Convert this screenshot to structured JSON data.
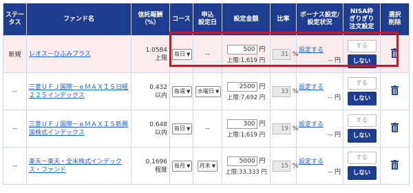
{
  "headers": {
    "status": "ステータス",
    "fund_name": "ファンド名",
    "fee": "信託報酬\n（%）",
    "course": "コース",
    "apply_date": "申込\n設定日",
    "amount": "設定金額",
    "ratio": "比率",
    "bonus": "ボーナス設定/\n設定状況",
    "nisa": "NISA枠\nぎりぎり\n注文設定",
    "delete": "選択\n削除"
  },
  "rows": [
    {
      "status": "新規",
      "fund": "レオス－ひふみプラス",
      "fee_value": "1.0584",
      "fee_note": "上限",
      "course": "毎日",
      "date": "--",
      "amount": "500",
      "yen": "円",
      "limit": "上限:1,619 円",
      "ratio": "31",
      "pct": "%",
      "bonus_link": "設定する",
      "bonus_status": "-- 円",
      "suru": "する",
      "shinai": "しない"
    },
    {
      "status": "--",
      "fund": "三菱ＵＦＪ国際－ｅＭＡＸＩＳ日経２２５インデックス",
      "fee_value": "0.432",
      "fee_note": "以内",
      "course": "毎週",
      "date": "水曜日",
      "amount": "2500",
      "yen": "円",
      "limit": "上限:7,692 円",
      "ratio": "33",
      "pct": "%",
      "bonus_link": "設定する",
      "bonus_status": "-- 円",
      "suru": "する",
      "shinai": "しない"
    },
    {
      "status": "--",
      "fund": "三菱ＵＦＪ国際－ｅＭＡＸＩＳ新興国株式インデックス",
      "fee_value": "0.648",
      "fee_note": "以内",
      "course": "毎日",
      "date": "--",
      "amount": "300",
      "yen": "円",
      "limit": "上限:1,619 円",
      "ratio": "19",
      "pct": "%",
      "bonus_link": "設定する",
      "bonus_status": "-- 円",
      "suru": "する",
      "shinai": "しない"
    },
    {
      "status": "--",
      "fund": "楽天－楽天・全米株式インデックス・ファンド",
      "fee_value": "0.1696",
      "fee_note": "程度",
      "course": "毎月",
      "date": "月末",
      "amount": "5000",
      "yen": "円",
      "limit": "上限:33,333 円",
      "ratio": "15",
      "pct": "%",
      "bonus_link": "設定する",
      "bonus_status": "-- 円",
      "suru": "する",
      "shinai": "しない"
    }
  ],
  "colors": {
    "header_bg": "#1f3d8f",
    "highlight_border": "#b5202a",
    "new_row_bg": "#fcecee",
    "link": "#1a5fd0"
  },
  "icons": {
    "delete": "trash-icon",
    "dropdown": "chevron-down-icon"
  }
}
